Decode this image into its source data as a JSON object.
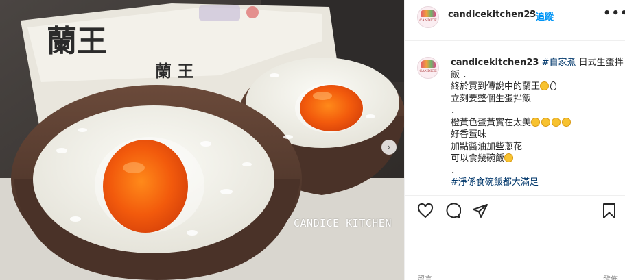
{
  "post": {
    "username": "candicekitchen23",
    "separator": "•",
    "follow_label": "追蹤",
    "more_label": "•••",
    "avatar_text": "CANDICE"
  },
  "photo": {
    "box_text_large": "蘭王",
    "box_text_small": "蘭 王",
    "watermark": "CANDICE KITCHEN",
    "next_arrow": "›"
  },
  "caption": {
    "username": "candicekitchen23",
    "tag1": "#自家煮",
    "title_rest": " 日式生蛋拌",
    "title_line2": "飯 ．",
    "line3": "終於買到傳說中的蘭王",
    "line4": "立刻要整個生蛋拌飯",
    "line5": "．",
    "line6": "橙黃色蛋黃實在太美",
    "line7": "好香蛋味",
    "line8": "加點醬油加些蔥花",
    "line9": "可以食幾碗飯",
    "line10": "．",
    "tag2": "#淨係食碗飯都大滿足"
  },
  "actions": {
    "like": "heart-icon",
    "comment": "comment-icon",
    "share": "share-icon",
    "save": "bookmark-icon"
  },
  "footer": {
    "left_text": "留言",
    "right_text": "發佈"
  }
}
